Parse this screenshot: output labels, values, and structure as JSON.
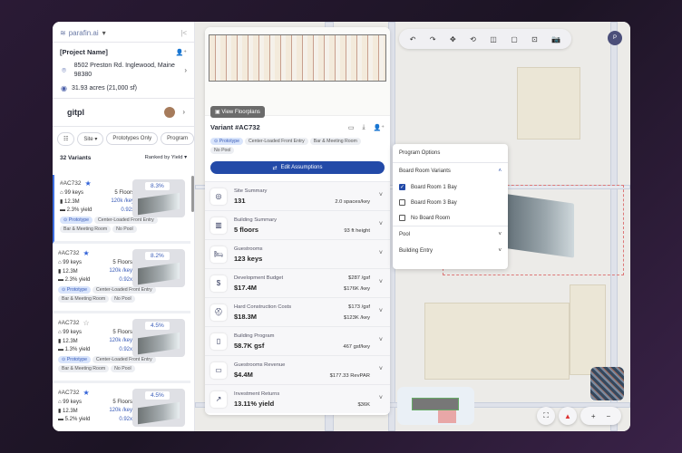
{
  "sidebar": {
    "brand": "parafin.ai",
    "project_name": "[Project Name]",
    "address": "8502 Preston Rd. Inglewood, Maine 98380",
    "area": "31.93 acres (21,000 sf)",
    "signature": "gitpl",
    "filters": [
      "Site",
      "Prototypes Only",
      "Program"
    ],
    "variants_count": "32 Variants",
    "sort": "Ranked by Yield",
    "cards": [
      {
        "id": "#AC732",
        "starred": true,
        "keys": "99 keys",
        "floors": "5 Floors",
        "cost": "12.3M",
        "per_key": "120k /key",
        "yield": "2.3% yield",
        "ratio": "0.92x",
        "pct": "8.3%",
        "tags": [
          "Prototype",
          "Center-Loaded Front Entry",
          "Bar & Meeting Room",
          "No Pool"
        ]
      },
      {
        "id": "#AC732",
        "starred": true,
        "keys": "99 keys",
        "floors": "5 Floors",
        "cost": "12.3M",
        "per_key": "120k /key",
        "yield": "2.3% yield",
        "ratio": "0.92x",
        "pct": "8.2%",
        "tags": [
          "Prototype",
          "Center-Loaded Front Entry",
          "Bar & Meeting Room",
          "No Pool"
        ]
      },
      {
        "id": "#AC732",
        "starred": false,
        "keys": "99 keys",
        "floors": "5 Floors",
        "cost": "12.3M",
        "per_key": "120k /key",
        "yield": "1.3% yield",
        "ratio": "0.92x",
        "pct": "4.5%",
        "tags": [
          "Prototype",
          "Center-Loaded Front Entry",
          "Bar & Meeting Room",
          "No Pool"
        ]
      },
      {
        "id": "#AC732",
        "starred": true,
        "keys": "99 keys",
        "floors": "5 Floors",
        "cost": "12.3M",
        "per_key": "120k /key",
        "yield": "5.2% yield",
        "ratio": "0.92x",
        "pct": "4.5%",
        "tags": []
      }
    ]
  },
  "detail": {
    "view_floorplans": "View Floorplans",
    "title": "Variant #AC732",
    "tags": [
      "Prototype",
      "Center-Loaded Front Entry",
      "Bar & Meeting Room",
      "No Pool"
    ],
    "edit_label": "Edit Assumptions",
    "sections": [
      {
        "label": "Site Summary",
        "value": "131",
        "right": "2.0 spaces/key",
        "right_top": "",
        "icon": "◎"
      },
      {
        "label": "Building Summary",
        "value": "5 floors",
        "right": "93 ft height",
        "right_top": "",
        "icon": "▥"
      },
      {
        "label": "Guestrooms",
        "value": "123 keys",
        "right": "",
        "right_top": "",
        "icon": "🛏"
      },
      {
        "label": "Development Budget",
        "value": "$17.4M",
        "right": "$176K /key",
        "right_top": "$287 /gsf",
        "icon": "$"
      },
      {
        "label": "Hard Construction Costs",
        "value": "$18.3M",
        "right": "$123K /key",
        "right_top": "$173 /gsf",
        "icon": "⛑"
      },
      {
        "label": "Building Program",
        "value": "58.7K gsf",
        "right": "467 gsf/key",
        "right_top": "",
        "icon": "▯"
      },
      {
        "label": "Guestrooms Revenue",
        "value": "$4.4M",
        "right": "$177.33 RevPAR",
        "right_top": "",
        "icon": "▭"
      },
      {
        "label": "Investment Returns",
        "value": "13.11% yield",
        "right": "$36K",
        "right_top": "",
        "icon": "↗"
      }
    ]
  },
  "program_options": {
    "title": "Program Options",
    "group": "Board Room Variants",
    "options": [
      {
        "label": "Board Room 1 Bay",
        "checked": true
      },
      {
        "label": "Board Room 3 Bay",
        "checked": false
      },
      {
        "label": "No Board Room",
        "checked": false
      }
    ],
    "pool": "Pool",
    "entry": "Building Entry"
  },
  "user_initial": "P",
  "colors": {
    "accent": "#234aa8",
    "star": "#3363d8"
  }
}
